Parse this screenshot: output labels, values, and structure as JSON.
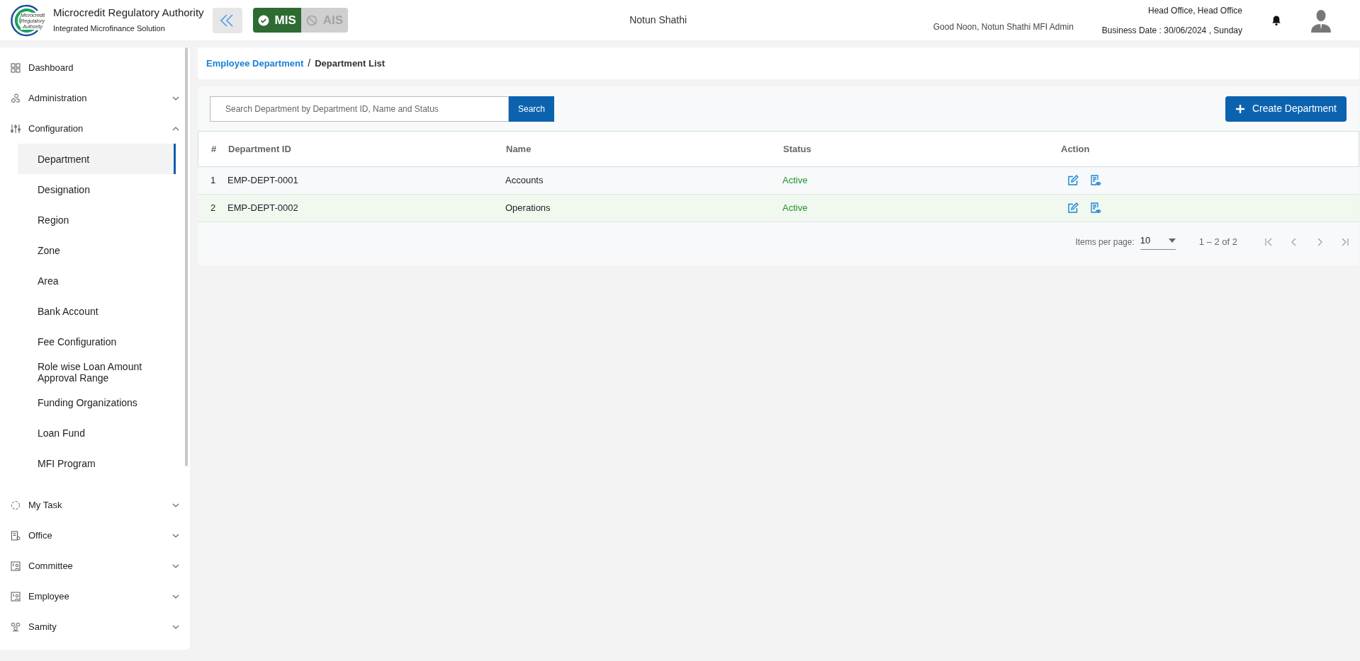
{
  "header": {
    "org_name": "Microcredit Regulatory Authority",
    "subtitle": "Integrated Microfinance Solution",
    "logo_text": [
      "Microcredit",
      "Regulatory",
      "Authority"
    ],
    "modules": [
      {
        "label": "MIS",
        "selected": true,
        "disabled": false
      },
      {
        "label": "AIS",
        "selected": false,
        "disabled": true
      }
    ],
    "mfi_name": "Notun Shathi",
    "greeting": "Good Noon, Notun Shathi MFI Admin",
    "office": "Head Office, Head Office",
    "business_date": "Business Date : 30/06/2024 , Sunday"
  },
  "sidebar": {
    "items": [
      {
        "label": "Dashboard",
        "kind": "link"
      },
      {
        "label": "Administration",
        "kind": "group",
        "expanded": false
      },
      {
        "label": "Configuration",
        "kind": "group",
        "expanded": true,
        "children": [
          {
            "label": "Department",
            "selected": true
          },
          {
            "label": "Designation",
            "selected": false
          },
          {
            "label": "Region",
            "selected": false
          },
          {
            "label": "Zone",
            "selected": false
          },
          {
            "label": "Area",
            "selected": false
          },
          {
            "label": "Bank Account",
            "selected": false
          },
          {
            "label": "Fee Configuration",
            "selected": false
          },
          {
            "label": "Role wise Loan Amount Approval Range",
            "selected": false
          },
          {
            "label": "Funding Organizations",
            "selected": false
          },
          {
            "label": "Loan Fund",
            "selected": false
          },
          {
            "label": "MFI Program",
            "selected": false
          }
        ]
      },
      {
        "label": "My Task",
        "kind": "group",
        "expanded": false
      },
      {
        "label": "Office",
        "kind": "group",
        "expanded": false
      },
      {
        "label": "Committee",
        "kind": "group",
        "expanded": false
      },
      {
        "label": "Employee",
        "kind": "group",
        "expanded": false
      },
      {
        "label": "Samity",
        "kind": "group",
        "expanded": false
      }
    ]
  },
  "breadcrumb": [
    {
      "label": "Employee Department",
      "kind": "link"
    },
    {
      "label": "Department List",
      "kind": "current"
    }
  ],
  "breadcrumb_separator": "/",
  "search": {
    "placeholder": "Search Department by Department ID, Name and Status",
    "button": "Search"
  },
  "create_button": "Create Department",
  "table": {
    "columns": [
      "#",
      "Department ID",
      "Name",
      "Status",
      "Action"
    ],
    "rows": [
      {
        "index": "1",
        "id": "EMP-DEPT-0001",
        "name": "Accounts",
        "status": "Active"
      },
      {
        "index": "2",
        "id": "EMP-DEPT-0002",
        "name": "Operations",
        "status": "Active"
      }
    ]
  },
  "paginator": {
    "label": "Items per page:",
    "page_size": "10",
    "range": "1 – 2 of 2"
  }
}
